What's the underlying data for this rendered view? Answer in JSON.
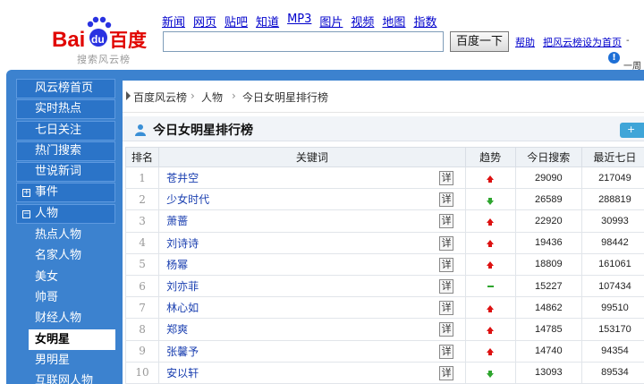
{
  "header": {
    "logo_text": "Baidu百度",
    "logo_sub": "搜索风云榜",
    "nav": [
      "新闻",
      "网页",
      "贴吧",
      "知道",
      "MP3",
      "图片",
      "视频",
      "地图",
      "指数"
    ],
    "search_value": "",
    "search_button": "百度一下",
    "help": "帮助",
    "set_home": "把风云榜设为首页",
    "cut_text": "-",
    "week_cut": "一周"
  },
  "sidebar": {
    "items": [
      "风云榜首页",
      "实时热点",
      "七日关注",
      "热门搜索",
      "世说新词"
    ],
    "groups": [
      {
        "label": "事件",
        "expanded": false
      },
      {
        "label": "人物",
        "expanded": true
      }
    ],
    "subitems": [
      "热点人物",
      "名家人物",
      "美女",
      "帅哥",
      "财经人物",
      "女明星",
      "男明星",
      "互联网人物"
    ],
    "active": "女明星"
  },
  "breadcrumb": [
    "百度风云榜",
    "人物",
    "今日女明星排行榜"
  ],
  "panel": {
    "title": "今日女明星排行榜",
    "plus_label": "+"
  },
  "table": {
    "headers": [
      "排名",
      "关键词",
      "趋势",
      "今日搜索",
      "最近七日"
    ],
    "detail_label": "详",
    "rows": [
      {
        "rank": "1",
        "keyword": "苍井空",
        "trend": "up",
        "today": "29090",
        "week": "217049"
      },
      {
        "rank": "2",
        "keyword": "少女时代",
        "trend": "down",
        "today": "26589",
        "week": "288819"
      },
      {
        "rank": "3",
        "keyword": "萧蔷",
        "trend": "up",
        "today": "22920",
        "week": "30993"
      },
      {
        "rank": "4",
        "keyword": "刘诗诗",
        "trend": "up",
        "today": "19436",
        "week": "98442"
      },
      {
        "rank": "5",
        "keyword": "杨幂",
        "trend": "up",
        "today": "18809",
        "week": "161061"
      },
      {
        "rank": "6",
        "keyword": "刘亦菲",
        "trend": "flat",
        "today": "15227",
        "week": "107434"
      },
      {
        "rank": "7",
        "keyword": "林心如",
        "trend": "up",
        "today": "14862",
        "week": "99510"
      },
      {
        "rank": "8",
        "keyword": "郑爽",
        "trend": "up",
        "today": "14785",
        "week": "153170"
      },
      {
        "rank": "9",
        "keyword": "张馨予",
        "trend": "up",
        "today": "14740",
        "week": "94354"
      },
      {
        "rank": "10",
        "keyword": "安以轩",
        "trend": "down",
        "today": "13093",
        "week": "89534"
      }
    ]
  },
  "colors": {
    "frame_blue": "#3c82cf",
    "link_blue": "#0000cc",
    "trend_up": "#d11111",
    "trend_down": "#2ea52e"
  }
}
